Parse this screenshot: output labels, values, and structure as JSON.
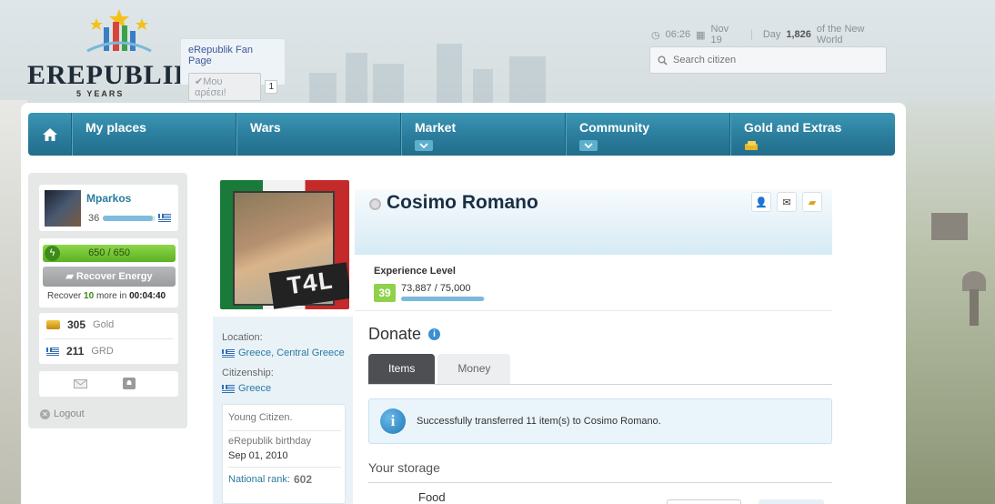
{
  "header": {
    "logo_text": "EREPUBLIK",
    "logo_subtitle": "5 YEARS",
    "fan_page": {
      "title": "eRepublik Fan Page",
      "like_label": "Μου αρέσει!",
      "like_count": "1"
    },
    "time": "06:26",
    "date": "Nov 19",
    "day_prefix": "Day",
    "day_number": "1,826",
    "day_suffix": "of the New World",
    "search_placeholder": "Search citizen"
  },
  "nav": {
    "items": [
      {
        "label": "My places"
      },
      {
        "label": "Wars"
      },
      {
        "label": "Market"
      },
      {
        "label": "Community"
      },
      {
        "label": "Gold and Extras"
      }
    ]
  },
  "sidebar": {
    "username": "Mparkos",
    "level": "36",
    "level_progress": 0.95,
    "energy": "650 / 650",
    "recover_label": "Recover Energy",
    "recover_prefix": "Recover",
    "recover_amount": "10",
    "recover_mid": "more in",
    "recover_timer": "00:04:40",
    "gold_amount": "305",
    "gold_label": "Gold",
    "currency_amount": "211",
    "currency_label": "GRD",
    "logout_label": "Logout"
  },
  "profile": {
    "name": "Cosimo Romano",
    "portrait_tag": "T4L",
    "experience_title": "Experience Level",
    "level": "39",
    "experience": "73,887 / 75,000",
    "experience_progress": 0.985,
    "location_label": "Location:",
    "location_value": "Greece, Central Greece",
    "citizenship_label": "Citizenship:",
    "citizenship_value": "Greece",
    "rank_title": "Young Citizen.",
    "birthday_label": "eRepublik birthday",
    "birthday_value": "Sep 01, 2010",
    "national_rank_label": "National rank:",
    "national_rank_value": "602"
  },
  "donate": {
    "title": "Donate",
    "tabs": [
      "Items",
      "Money"
    ],
    "active_tab": "Items",
    "message": "Successfully transferred 11 item(s) to Cosimo Romano.",
    "storage_title": "Your storage",
    "food_label": "Food"
  },
  "colors": {
    "nav": "#2b7d9c",
    "link": "#2a7ba0",
    "energy": "#5bb222",
    "level_badge": "#8fd14a"
  }
}
